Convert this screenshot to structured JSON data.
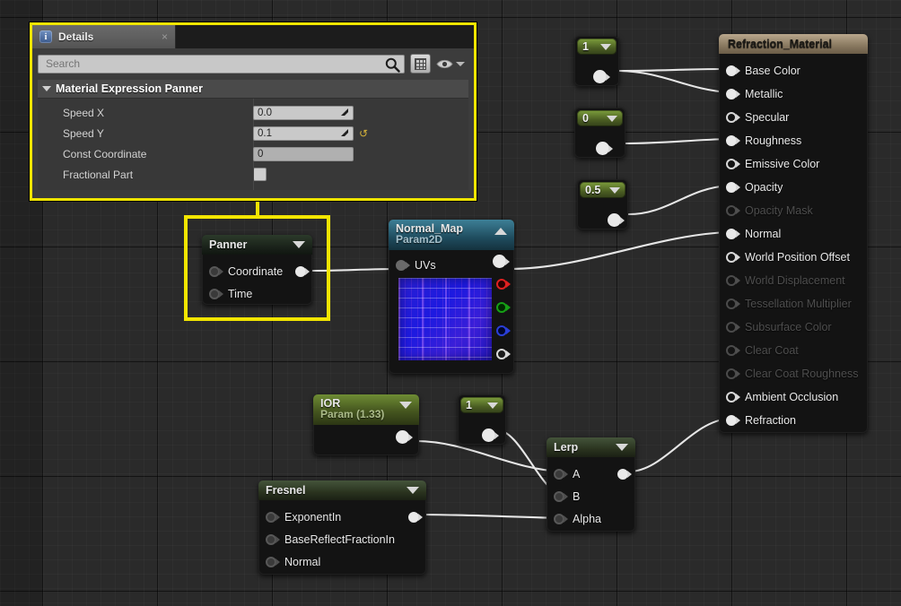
{
  "app": {
    "editor": "unreal-material-editor"
  },
  "details_panel": {
    "tab": {
      "label": "Details",
      "icon": "details-info-icon",
      "close": "×"
    },
    "search": {
      "placeholder": "Search",
      "value": "",
      "icon": "search-icon"
    },
    "toolbar": {
      "grid_icon": "grid-view-icon",
      "eye_icon": "eye-visibility-icon",
      "dropdown_icon": "chevron-down-icon"
    },
    "category": {
      "label": "Material Expression Panner",
      "expander": "triangle-down-icon"
    },
    "properties": [
      {
        "label": "Speed X",
        "value": "0.0",
        "type": "number",
        "has_spinner": true,
        "has_reset": false
      },
      {
        "label": "Speed Y",
        "value": "0.1",
        "type": "number",
        "has_spinner": true,
        "has_reset": true,
        "reset_icon": "reset-arrow-icon"
      },
      {
        "label": "Const Coordinate",
        "value": "0",
        "type": "number-readonly",
        "has_spinner": false,
        "has_reset": false
      },
      {
        "label": "Fractional Part",
        "value": "",
        "type": "checkbox",
        "checked": false,
        "has_spinner": false,
        "has_reset": false
      }
    ]
  },
  "nodes": {
    "panner": {
      "title": "Panner",
      "caret": "caret-down-icon",
      "inputs": [
        {
          "label": "Coordinate",
          "pin": "input-pin"
        },
        {
          "label": "Time",
          "pin": "input-pin"
        }
      ],
      "outputs": [
        {
          "label": "",
          "pin": "output-pin"
        }
      ],
      "highlighted": true
    },
    "normal_map": {
      "title": "Normal_Map",
      "subtitle": "Param2D",
      "caret": "caret-up-icon",
      "inputs": [
        {
          "label": "UVs",
          "pin": "input-pin"
        }
      ],
      "outputs": [
        {
          "label": "RGB",
          "pin": "output-pin-white"
        },
        {
          "label": "R",
          "pin": "output-pin-red"
        },
        {
          "label": "G",
          "pin": "output-pin-green"
        },
        {
          "label": "B",
          "pin": "output-pin-blue"
        },
        {
          "label": "A",
          "pin": "output-pin-alpha"
        }
      ],
      "thumbnail": "normal-map-brick-texture"
    },
    "ior": {
      "title": "IOR",
      "subtitle": "Param (1.33)",
      "caret": "caret-down-icon",
      "outputs": [
        {
          "label": "",
          "pin": "output-pin"
        }
      ]
    },
    "fresnel": {
      "title": "Fresnel",
      "caret": "caret-down-icon",
      "inputs": [
        {
          "label": "ExponentIn",
          "pin": "input-pin"
        },
        {
          "label": "BaseReflectFractionIn",
          "pin": "input-pin"
        },
        {
          "label": "Normal",
          "pin": "input-pin"
        }
      ],
      "outputs": [
        {
          "label": "",
          "pin": "output-pin"
        }
      ]
    },
    "lerp": {
      "title": "Lerp",
      "caret": "caret-down-icon",
      "inputs": [
        {
          "label": "A",
          "pin": "input-pin"
        },
        {
          "label": "B",
          "pin": "input-pin"
        },
        {
          "label": "Alpha",
          "pin": "input-pin"
        }
      ],
      "outputs": [
        {
          "label": "",
          "pin": "output-pin"
        }
      ]
    },
    "constants": [
      {
        "id": "const-1-top",
        "value": "1",
        "caret": "caret-down-icon"
      },
      {
        "id": "const-0",
        "value": "0",
        "caret": "caret-down-icon"
      },
      {
        "id": "const-05",
        "value": "0.5",
        "caret": "caret-down-icon"
      },
      {
        "id": "const-1-lerp",
        "value": "1",
        "caret": "caret-down-icon"
      }
    ],
    "material_output": {
      "title": "Refraction_Material",
      "inputs": [
        {
          "label": "Base Color",
          "state": "connected"
        },
        {
          "label": "Metallic",
          "state": "connected"
        },
        {
          "label": "Specular",
          "state": "enabled"
        },
        {
          "label": "Roughness",
          "state": "connected"
        },
        {
          "label": "Emissive Color",
          "state": "enabled"
        },
        {
          "label": "Opacity",
          "state": "connected"
        },
        {
          "label": "Opacity Mask",
          "state": "disabled"
        },
        {
          "label": "Normal",
          "state": "connected"
        },
        {
          "label": "World Position Offset",
          "state": "enabled"
        },
        {
          "label": "World Displacement",
          "state": "disabled"
        },
        {
          "label": "Tessellation Multiplier",
          "state": "disabled"
        },
        {
          "label": "Subsurface Color",
          "state": "disabled"
        },
        {
          "label": "Clear Coat",
          "state": "disabled"
        },
        {
          "label": "Clear Coat Roughness",
          "state": "disabled"
        },
        {
          "label": "Ambient Occlusion",
          "state": "enabled"
        },
        {
          "label": "Refraction",
          "state": "connected"
        }
      ]
    }
  },
  "colors": {
    "highlight": "#f2e500",
    "wire": "#e6e6e6",
    "canvas": "#2a2a2a",
    "const_header": "#6e8c34",
    "texture_header": "#3d7f96",
    "output_header": "#b9a78c"
  }
}
